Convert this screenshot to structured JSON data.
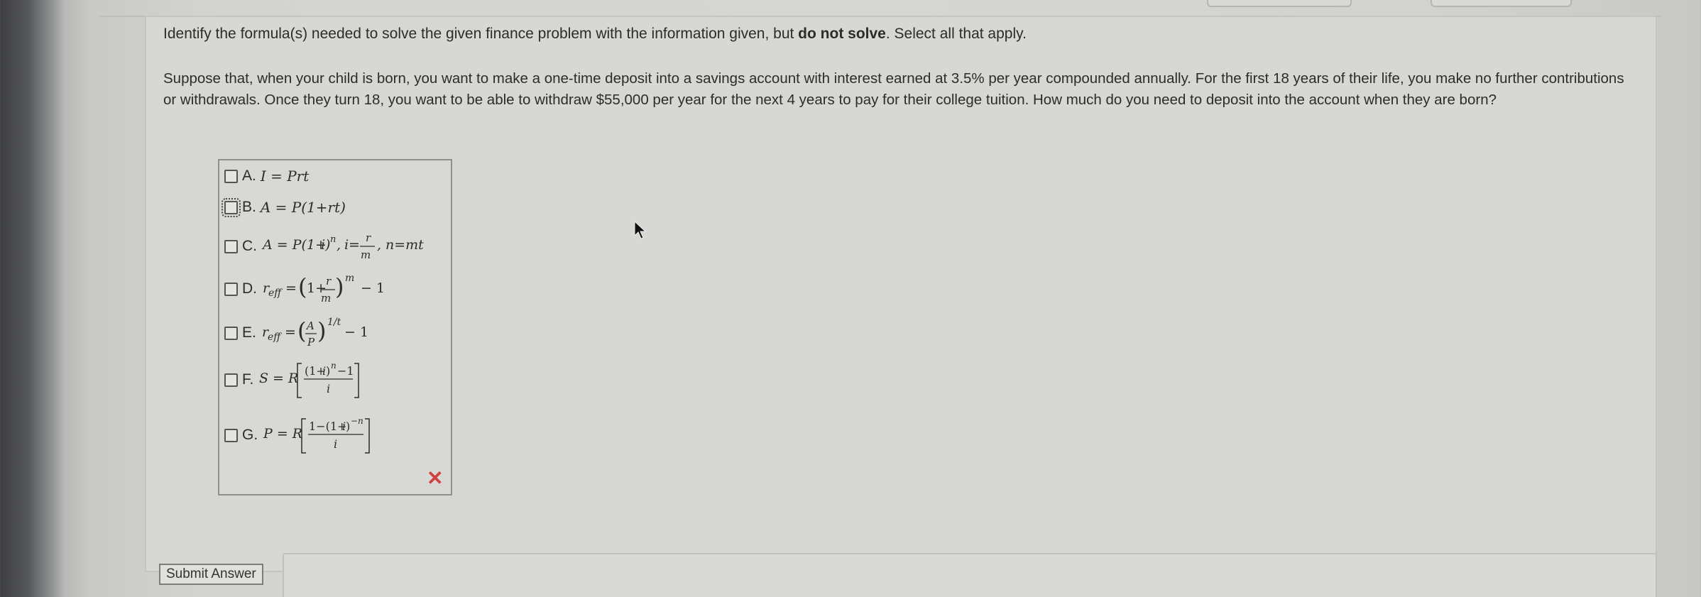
{
  "instruction": {
    "before": "Identify the formula(s) needed to solve the given finance problem with the information given, but ",
    "bold": "do not solve",
    "after": ". Select all that apply."
  },
  "problem_text": "Suppose that, when your child is born, you want to make a one-time deposit into a savings account with interest earned at 3.5% per year compounded annually. For the first 18 years of their life, you make no further contributions or withdrawals. Once they turn 18, you want to be able to withdraw $55,000 per year for the next 4 years to pay for their college tuition. How much do you need to deposit into the account when they are born?",
  "choices": [
    {
      "letter": "A.",
      "formula": "I = Prt",
      "checked": false
    },
    {
      "letter": "B.",
      "formula": "A = P(1+rt)",
      "checked": false
    },
    {
      "letter": "C.",
      "formula": "A = P(1+i)ⁿ, i = r/m, n = mt",
      "checked": false
    },
    {
      "letter": "D.",
      "formula": "r_eff = (1 + r/m)^m − 1",
      "checked": false
    },
    {
      "letter": "E.",
      "formula": "r_eff = (A/P)^(1/t) − 1",
      "checked": false
    },
    {
      "letter": "F.",
      "formula": "S = R[((1+i)ⁿ − 1)/i]",
      "checked": false
    },
    {
      "letter": "G.",
      "formula": "P = R[(1 − (1+i)⁻ⁿ)/i]",
      "checked": false
    }
  ],
  "submit_label": "Submit Answer",
  "icons": {
    "close": "close-x-icon",
    "cursor": "mouse-pointer-icon"
  },
  "colors": {
    "close_x": "#d04040",
    "panel": "#d7d7d4"
  }
}
